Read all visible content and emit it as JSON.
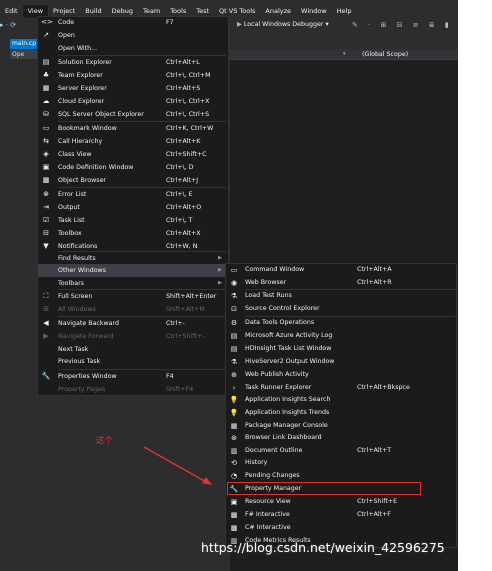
{
  "menubar": [
    "Edit",
    "View",
    "Project",
    "Build",
    "Debug",
    "Team",
    "Tools",
    "Test",
    "Qt VS Tools",
    "Analyze",
    "Window",
    "Help"
  ],
  "toolbar": {
    "debugger_label": "Local Windows Debugger",
    "scope_label": "(Global Scope)"
  },
  "tabs": {
    "main": "main.cp",
    "ope": "Ope"
  },
  "view_menu": [
    {
      "icon": "<>",
      "label": "Code",
      "shortcut": "F7",
      "disabled": false
    },
    {
      "icon": "↗",
      "label": "Open",
      "shortcut": "",
      "disabled": false
    },
    {
      "icon": "",
      "label": "Open With...",
      "shortcut": "",
      "disabled": false
    },
    {
      "icon": "▤",
      "label": "Solution Explorer",
      "shortcut": "Ctrl+Alt+L",
      "disabled": false
    },
    {
      "icon": "♣",
      "label": "Team Explorer",
      "shortcut": "Ctrl+\\, Ctrl+M",
      "disabled": false
    },
    {
      "icon": "▦",
      "label": "Server Explorer",
      "shortcut": "Ctrl+Alt+S",
      "disabled": false
    },
    {
      "icon": "☁",
      "label": "Cloud Explorer",
      "shortcut": "Ctrl+\\, Ctrl+X",
      "disabled": false
    },
    {
      "icon": "⛁",
      "label": "SQL Server Object Explorer",
      "shortcut": "Ctrl+\\, Ctrl+S",
      "disabled": false
    },
    {
      "icon": "▭",
      "label": "Bookmark Window",
      "shortcut": "Ctrl+K, Ctrl+W",
      "disabled": false
    },
    {
      "icon": "⇆",
      "label": "Call Hierarchy",
      "shortcut": "Ctrl+Alt+K",
      "disabled": false
    },
    {
      "icon": "◈",
      "label": "Class View",
      "shortcut": "Ctrl+Shift+C",
      "disabled": false
    },
    {
      "icon": "▣",
      "label": "Code Definition Window",
      "shortcut": "Ctrl+\\, D",
      "disabled": false
    },
    {
      "icon": "▩",
      "label": "Object Browser",
      "shortcut": "Ctrl+Alt+J",
      "disabled": false
    },
    {
      "icon": "⊗",
      "label": "Error List",
      "shortcut": "Ctrl+\\, E",
      "disabled": false
    },
    {
      "icon": "⇥",
      "label": "Output",
      "shortcut": "Ctrl+Alt+O",
      "disabled": false
    },
    {
      "icon": "☑",
      "label": "Task List",
      "shortcut": "Ctrl+\\, T",
      "disabled": false
    },
    {
      "icon": "⊟",
      "label": "Toolbox",
      "shortcut": "Ctrl+Alt+X",
      "disabled": false
    },
    {
      "icon": "▼",
      "label": "Notifications",
      "shortcut": "Ctrl+W, N",
      "disabled": false
    },
    {
      "icon": "",
      "label": "Find Results",
      "shortcut": "",
      "disabled": false,
      "submenu": true
    },
    {
      "icon": "",
      "label": "Other Windows",
      "shortcut": "",
      "disabled": false,
      "submenu": true,
      "highlight": true
    },
    {
      "icon": "",
      "label": "Toolbars",
      "shortcut": "",
      "disabled": false,
      "submenu": true
    },
    {
      "icon": "⛶",
      "label": "Full Screen",
      "shortcut": "Shift+Alt+Enter",
      "disabled": false
    },
    {
      "icon": "⊞",
      "label": "All Windows",
      "shortcut": "Shift+Alt+M",
      "disabled": true
    },
    {
      "icon": "◀",
      "label": "Navigate Backward",
      "shortcut": "Ctrl+-",
      "disabled": false
    },
    {
      "icon": "▶",
      "label": "Navigate Forward",
      "shortcut": "Ctrl+Shift+-",
      "disabled": true
    },
    {
      "icon": "",
      "label": "Next Task",
      "shortcut": "",
      "disabled": false
    },
    {
      "icon": "",
      "label": "Previous Task",
      "shortcut": "",
      "disabled": false
    },
    {
      "icon": "🔧",
      "label": "Properties Window",
      "shortcut": "F4",
      "disabled": false
    },
    {
      "icon": "",
      "label": "Property Pages",
      "shortcut": "Shift+F4",
      "disabled": true
    }
  ],
  "other_windows": [
    {
      "icon": "▭",
      "label": "Command Window",
      "shortcut": "Ctrl+Alt+A"
    },
    {
      "icon": "◉",
      "label": "Web Browser",
      "shortcut": "Ctrl+Alt+R"
    },
    {
      "icon": "⚗",
      "label": "Load Test Runs",
      "shortcut": ""
    },
    {
      "icon": "⊡",
      "label": "Source Control Explorer",
      "shortcut": ""
    },
    {
      "icon": "⚙",
      "label": "Data Tools Operations",
      "shortcut": ""
    },
    {
      "icon": "▤",
      "label": "Microsoft Azure Activity Log",
      "shortcut": ""
    },
    {
      "icon": "▤",
      "label": "HDInsight Task List Window",
      "shortcut": ""
    },
    {
      "icon": "⚗",
      "label": "HiveServer2 Output Window",
      "shortcut": ""
    },
    {
      "icon": "⊕",
      "label": "Web Publish Activity",
      "shortcut": ""
    },
    {
      "icon": "›",
      "label": "Task Runner Explorer",
      "shortcut": "Ctrl+Alt+Bkspce"
    },
    {
      "icon": "💡",
      "label": "Application Insights Search",
      "shortcut": ""
    },
    {
      "icon": "💡",
      "label": "Application Insights Trends",
      "shortcut": ""
    },
    {
      "icon": "▦",
      "label": "Package Manager Console",
      "shortcut": ""
    },
    {
      "icon": "⊛",
      "label": "Browser Link Dashboard",
      "shortcut": ""
    },
    {
      "icon": "▥",
      "label": "Document Outline",
      "shortcut": "Ctrl+Alt+T"
    },
    {
      "icon": "⟲",
      "label": "History",
      "shortcut": ""
    },
    {
      "icon": "◔",
      "label": "Pending Changes",
      "shortcut": ""
    },
    {
      "icon": "🔧",
      "label": "Property Manager",
      "shortcut": ""
    },
    {
      "icon": "▣",
      "label": "Resource View",
      "shortcut": "Ctrl+Shift+E"
    },
    {
      "icon": "▩",
      "label": "F# Interactive",
      "shortcut": "Ctrl+Alt+F"
    },
    {
      "icon": "▩",
      "label": "C# Interactive",
      "shortcut": ""
    },
    {
      "icon": "▥",
      "label": "Code Metrics Results",
      "shortcut": ""
    }
  ],
  "annotation": "这个",
  "watermark": "https://blog.csdn.net/weixin_42596275",
  "colors": {
    "highlight_box": "#e0352f",
    "menu_bg": "#1b1b1c",
    "accent": "#007acc"
  }
}
